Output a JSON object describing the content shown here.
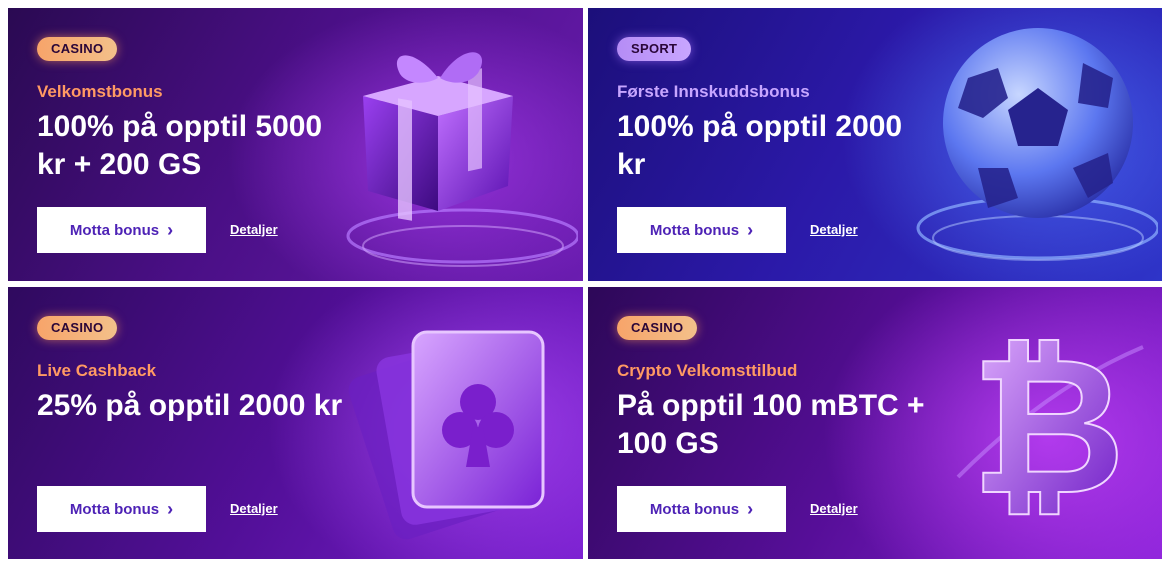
{
  "cards": [
    {
      "tag": "CASINO",
      "subtitle": "Velkomstbonus",
      "headline": "100% på opptil 5000 kr + 200 GS",
      "button_label": "Motta bonus",
      "details_label": "Detaljer",
      "illustration": "gift-box-icon"
    },
    {
      "tag": "SPORT",
      "subtitle": "Første Innskuddsbonus",
      "headline": "100% på opptil 2000 kr",
      "button_label": "Motta bonus",
      "details_label": "Detaljer",
      "illustration": "soccer-ball-icon"
    },
    {
      "tag": "CASINO",
      "subtitle": "Live Cashback",
      "headline": "25% på opptil 2000 kr",
      "button_label": "Motta bonus",
      "details_label": "Detaljer",
      "illustration": "playing-cards-club-icon"
    },
    {
      "tag": "CASINO",
      "subtitle": "Crypto Velkomsttilbud",
      "headline": "På opptil 100 mBTC + 100 GS",
      "button_label": "Motta bonus",
      "details_label": "Detaljer",
      "illustration": "bitcoin-icon"
    }
  ],
  "colors": {
    "casino_pill": "#f7a46a",
    "sport_pill": "#b58cf5",
    "casino_subtitle": "#ff9a63",
    "sport_subtitle": "#c7a6ff",
    "button_text": "#4e23b6"
  },
  "icons": {
    "chevron": "chevron-right-icon"
  }
}
